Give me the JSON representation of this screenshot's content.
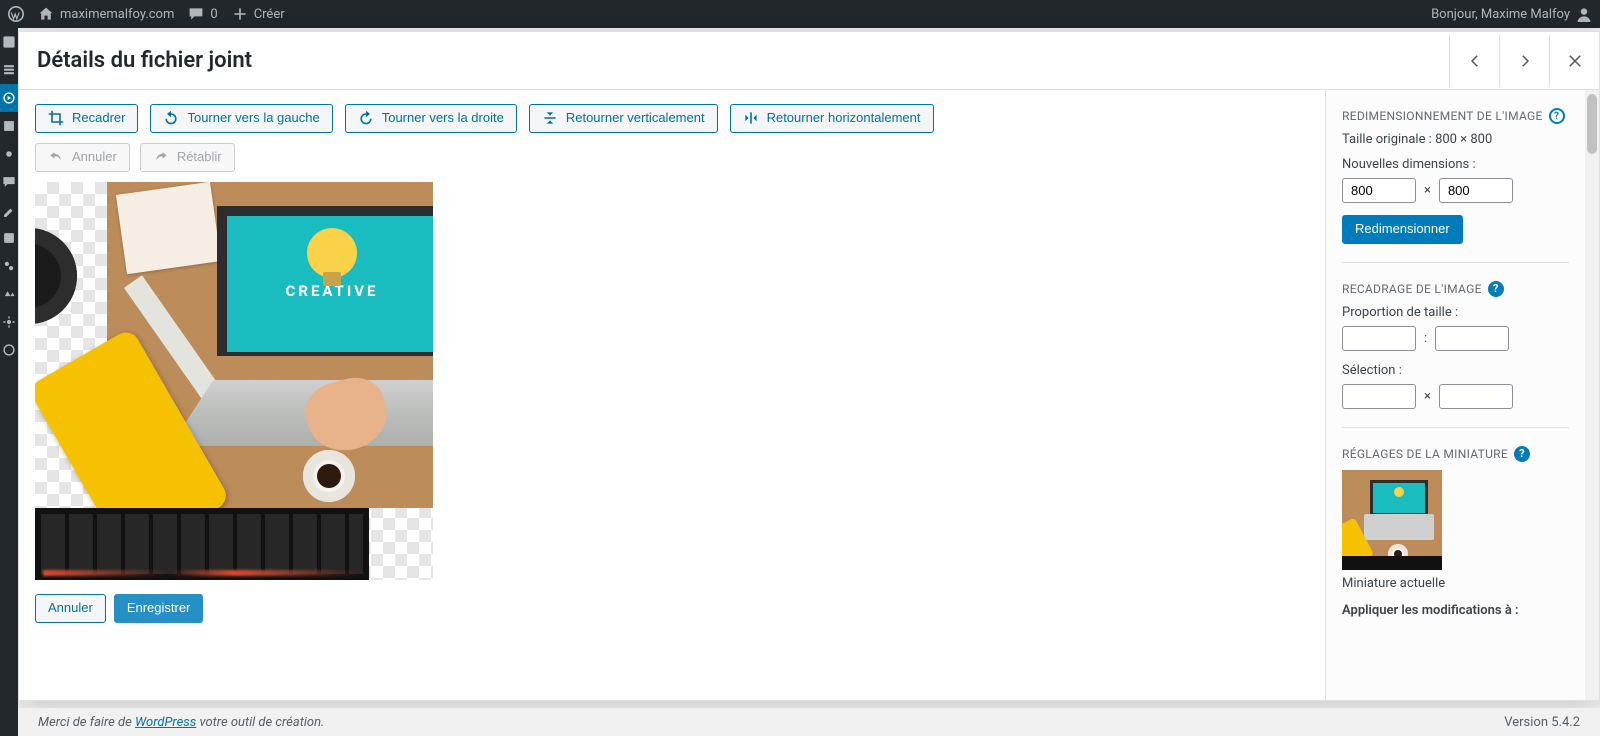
{
  "admin_bar": {
    "site_name": "maximemalfoy.com",
    "comments_count": "0",
    "new_label": "Créer",
    "greeting": "Bonjour, Maxime Malfoy"
  },
  "modal": {
    "title": "Détails du fichier joint"
  },
  "toolbar": {
    "crop": "Recadrer",
    "rotate_left": "Tourner vers la gauche",
    "rotate_right": "Tourner vers la droite",
    "flip_v": "Retourner verticalement",
    "flip_h": "Retourner horizontalement",
    "undo": "Annuler",
    "redo": "Rétablir"
  },
  "image_text": "CREATIVE",
  "actions": {
    "cancel": "Annuler",
    "save": "Enregistrer"
  },
  "scale": {
    "heading": "REDIMENSIONNEMENT DE L'IMAGE",
    "original_label": "Taille originale : ",
    "original_value": "800 × 800",
    "new_dims_label": "Nouvelles dimensions :",
    "width": "800",
    "height": "800",
    "button": "Redimensionner"
  },
  "crop": {
    "heading": "RECADRAGE DE L'IMAGE",
    "aspect_label": "Proportion de taille :",
    "selection_label": "Sélection :"
  },
  "thumb": {
    "heading": "RÉGLAGES DE LA MINIATURE",
    "caption": "Miniature actuelle",
    "apply_label": "Appliquer les modifications à :"
  },
  "footer": {
    "prefix": "Merci de faire de ",
    "link": "WordPress",
    "suffix": " votre outil de création.",
    "version": "Version 5.4.2"
  }
}
